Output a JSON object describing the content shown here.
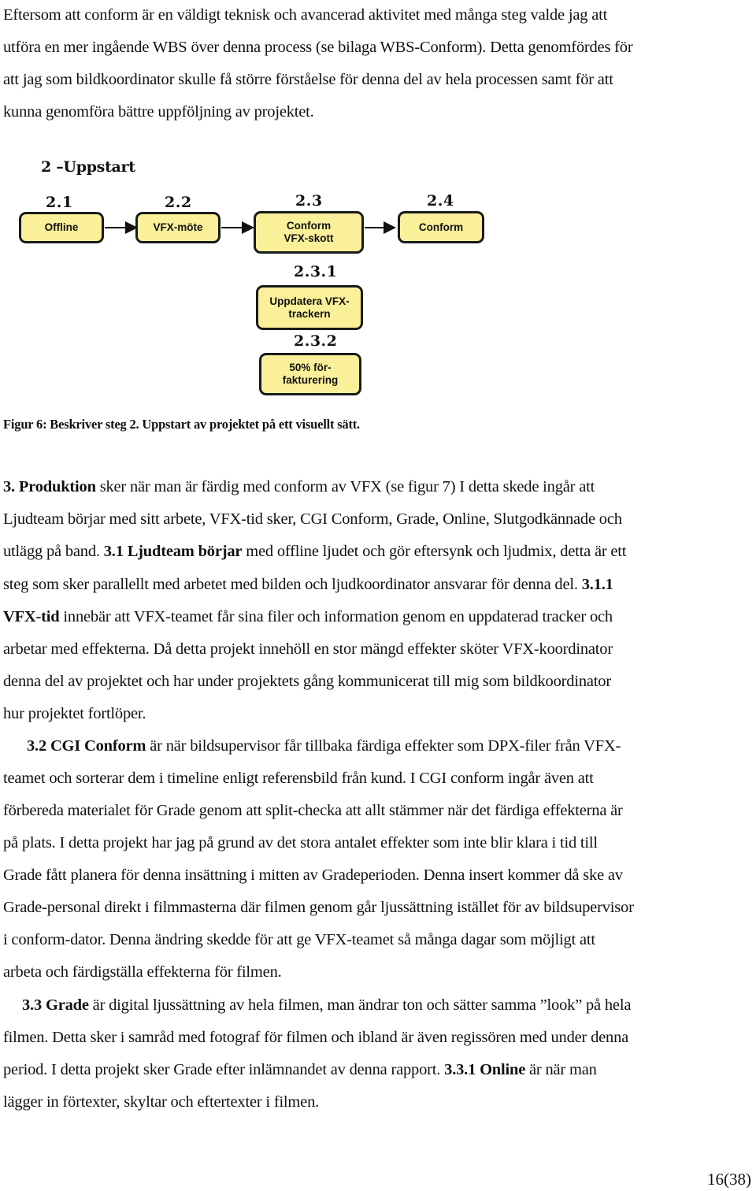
{
  "intro": {
    "lines": [
      "Eftersom att conform är en väldigt teknisk och avancerad aktivitet med många steg valde jag att",
      "utföra en mer ingående WBS över denna process (se bilaga WBS-Conform). Detta genomfördes för",
      "att jag som bildkoordinator skulle få större förståelse för denna del av hela processen samt för att",
      "kunna genomföra bättre uppföljning av projektet."
    ]
  },
  "figure": {
    "title": "2 –Uppstart",
    "steps": [
      {
        "number": "2.1",
        "label": "Offline"
      },
      {
        "number": "2.2",
        "label": "VFX-möte"
      },
      {
        "number": "2.3",
        "label": "Conform\nVFX-skott"
      },
      {
        "number": "2.4",
        "label": "Conform"
      }
    ],
    "substeps": [
      {
        "number": "2.3.1",
        "label": "Uppdatera VFX-\ntrackern"
      },
      {
        "number": "2.3.2",
        "label": "50% för-\nfakturering"
      }
    ],
    "box_color": "#fbf09a",
    "caption": "Figur 6: Beskriver steg 2. Uppstart av projektet på ett visuellt sätt."
  },
  "body": {
    "p1": {
      "l1_bold": "3. Produktion",
      "l1": " sker när man är färdig med conform av VFX (se figur 7) I detta skede ingår att",
      "l2": "Ljudteam börjar med sitt arbete, VFX-tid sker, CGI Conform, Grade, Online, Slutgodkännade och",
      "l3_a": "utlägg på band. ",
      "l3_bold": "3.1 Ljudteam börjar",
      "l3_b": " med offline ljudet och gör eftersynk och ljudmix, detta är ett",
      "l4_a": "steg som sker parallellt med arbetet med bilden och ljudkoordinator ansvarar för denna del. ",
      "l4_bold": "3.1.1",
      "l5_bold": "VFX-tid",
      "l5": " innebär att VFX-teamet får sina filer och information genom en uppdaterad tracker och",
      "l6": "arbetar med effekterna. Då detta projekt innehöll en stor mängd effekter sköter VFX-koordinator",
      "l7": "denna del av projektet och har under projektets gång kommunicerat till mig som bildkoordinator",
      "l8": "hur projektet fortlöper."
    },
    "p2": {
      "l1_bold": "3.2 CGI Conform",
      "l1": " är när bildsupervisor får tillbaka färdiga effekter som DPX-filer från VFX-",
      "l2": "teamet och sorterar dem i timeline enligt referensbild från kund. I CGI conform ingår även att",
      "l3": "förbereda materialet för Grade genom att split-checka att allt stämmer när det färdiga effekterna är",
      "l4": "på plats. I detta projekt har jag på grund av det stora antalet effekter som inte blir klara i tid till",
      "l5": "Grade fått planera för denna insättning i mitten av Gradeperioden. Denna insert kommer då ske av",
      "l6": "Grade-personal direkt i filmmasterna där filmen genom går ljussättning istället för av bildsupervisor",
      "l7": "i conform-dator. Denna ändring skedde för att ge VFX-teamet så många dagar som möjligt att",
      "l8": "arbeta och färdigställa effekterna för filmen."
    },
    "p3": {
      "l1_bold": "3.3 Grade",
      "l1": " är digital ljussättning av hela filmen, man ändrar ton och sätter samma ”look” på hela",
      "l2": "filmen. Detta sker i samråd med fotograf för filmen och ibland är även regissören med under denna",
      "l3_a": "period. I detta projekt sker Grade efter inlämnandet av denna rapport. ",
      "l3_bold": "3.3.1 Online",
      "l3_b": " är när man",
      "l4": "lägger in förtexter, skyltar och eftertexter i filmen."
    }
  },
  "footer": {
    "page_number": "16(38)"
  }
}
